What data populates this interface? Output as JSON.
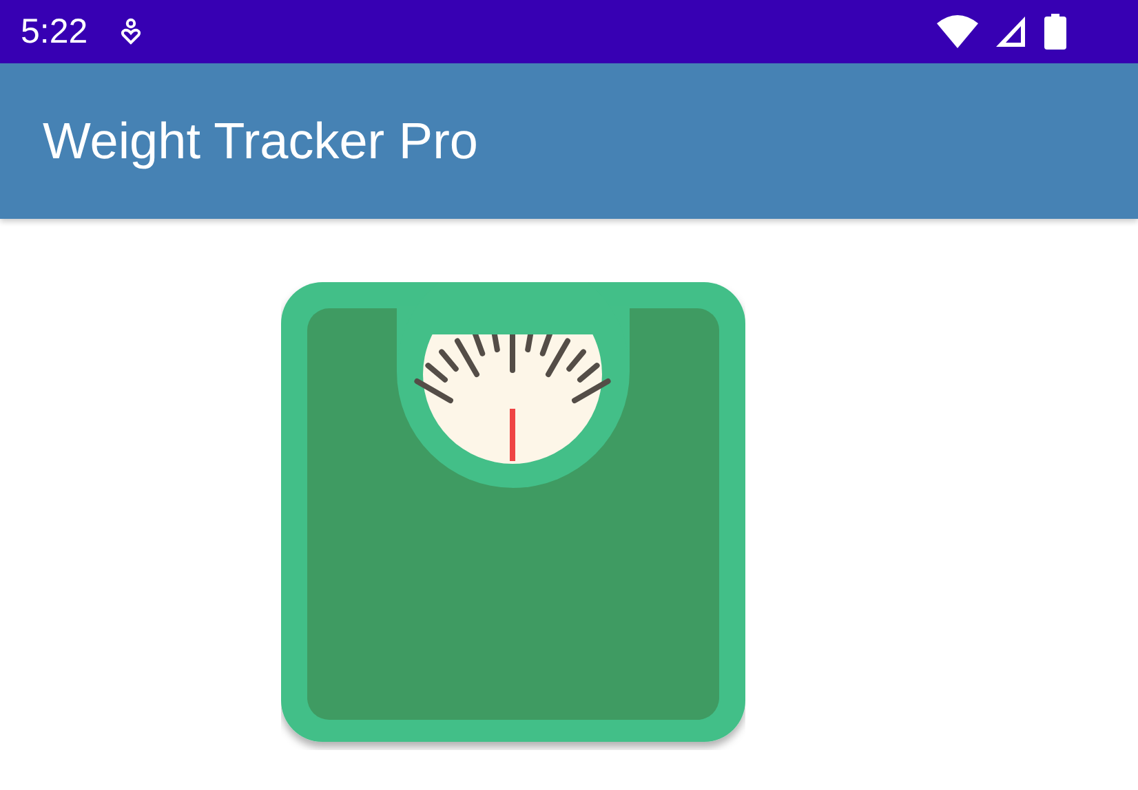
{
  "status_bar": {
    "time": "5:22"
  },
  "app_bar": {
    "title": "Weight Tracker Pro"
  }
}
